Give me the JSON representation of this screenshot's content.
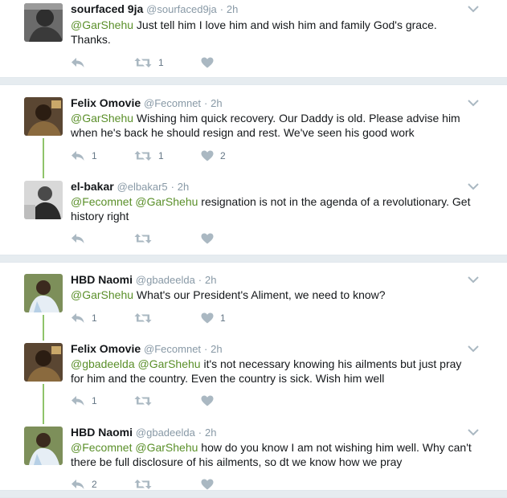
{
  "colors": {
    "mention": "#5a8f29",
    "thread_line": "#8fc46a",
    "muted": "#8899a6",
    "separator": "#e6ecf0"
  },
  "tweets": [
    {
      "name": "sourfaced 9ja",
      "handle": "@sourfaced9ja",
      "dot": "·",
      "time": "2h",
      "mentions": [
        "@GarShehu"
      ],
      "text": " Just tell him I love him and wish him and family God's grace.",
      "text2": "Thanks.",
      "reply_count": "",
      "retweet_count": "1",
      "like_count": ""
    },
    {
      "name": "Felix Omovie",
      "handle": "@Fecomnet",
      "dot": "·",
      "time": "2h",
      "mentions": [
        "@GarShehu"
      ],
      "text": " Wishing him quick recovery. Our Daddy is old. Please advise him",
      "text2": "when he's back he should resign and rest. We've seen his good work",
      "reply_count": "1",
      "retweet_count": "1",
      "like_count": "2"
    },
    {
      "name": "el-bakar",
      "handle": "@elbakar5",
      "dot": "·",
      "time": "2h",
      "mentions": [
        "@Fecomnet",
        "@GarShehu"
      ],
      "text": " resignation is not in the agenda of a revolutionary. Get",
      "text2": "history right",
      "reply_count": "",
      "retweet_count": "",
      "like_count": ""
    },
    {
      "name": "HBD Naomi",
      "handle": "@gbadeelda",
      "dot": "·",
      "time": "2h",
      "mentions": [
        "@GarShehu"
      ],
      "text": " What's our President's Aliment, we need to know?",
      "text2": "",
      "reply_count": "1",
      "retweet_count": "",
      "like_count": "1"
    },
    {
      "name": "Felix Omovie",
      "handle": "@Fecomnet",
      "dot": "·",
      "time": "2h",
      "mentions": [
        "@gbadeelda",
        "@GarShehu"
      ],
      "text": " it's not necessary knowing his ailments but just pray",
      "text2": "for him and the country. Even the country is sick. Wish him well",
      "reply_count": "1",
      "retweet_count": "",
      "like_count": ""
    },
    {
      "name": "HBD Naomi",
      "handle": "@gbadeelda",
      "dot": "·",
      "time": "2h",
      "mentions": [
        "@Fecomnet",
        "@GarShehu"
      ],
      "text": " how do you know I am not wishing him well. Why can't",
      "text2": "there be full disclosure of his ailments, so dt we know how we pray",
      "reply_count": "2",
      "retweet_count": "",
      "like_count": ""
    }
  ]
}
